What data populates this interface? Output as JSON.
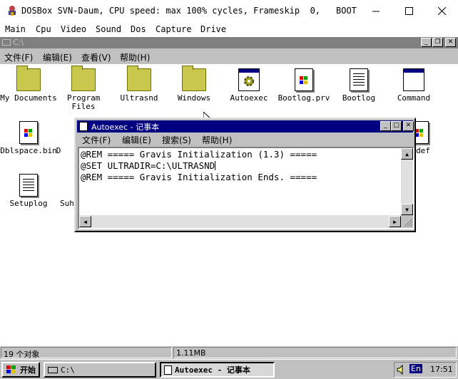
{
  "host": {
    "title": "DOSBox SVN-Daum, CPU speed: max 100% cycles, Frameskip  0,",
    "boot": "BOOT",
    "menu": [
      "Main",
      "Cpu",
      "Video",
      "Sound",
      "Dos",
      "Capture",
      "Drive"
    ]
  },
  "explorer": {
    "title": "C:\\",
    "menu": [
      "文件(F)",
      "编辑(E)",
      "查看(V)",
      "帮助(H)"
    ],
    "icons": [
      {
        "label": "My Documents",
        "kind": "folder"
      },
      {
        "label": "Program Files",
        "kind": "folder"
      },
      {
        "label": "Ultrasnd",
        "kind": "folder"
      },
      {
        "label": "Windows",
        "kind": "folder"
      },
      {
        "label": "Autoexec",
        "kind": "gear"
      },
      {
        "label": "Bootlog.prv",
        "kind": "winlogo"
      },
      {
        "label": "Bootlog",
        "kind": "doc"
      },
      {
        "label": "Command",
        "kind": "app"
      },
      {
        "label": "Dblspace.bin",
        "kind": "winlogo"
      },
      {
        "label": "D",
        "kind": "partial"
      },
      {
        "label": "def",
        "kind": "winlogo"
      },
      {
        "label": "Setuplog",
        "kind": "doc"
      },
      {
        "label": "Suh",
        "kind": "partial"
      }
    ],
    "status": {
      "count": "19 个对象",
      "size": "1.11MB"
    }
  },
  "notepad": {
    "title": "Autoexec - 记事本",
    "menu": [
      "文件(F)",
      "编辑(E)",
      "搜索(S)",
      "帮助(H)"
    ],
    "lines": [
      "@REM ===== Gravis Initialization (1.3) =====",
      "@SET ULTRADIR=C:\\ULTRASND",
      "@REM ===== Gravis Initialization Ends. ====="
    ]
  },
  "taskbar": {
    "start": "开始",
    "tasks": [
      "C:\\",
      "Autoexec - 记事本"
    ],
    "lang": "En",
    "clock": "17:51"
  },
  "colors": {
    "title_active": "#000080",
    "folder": "#c8c84c",
    "desktop_gray": "#c0c0c0"
  }
}
